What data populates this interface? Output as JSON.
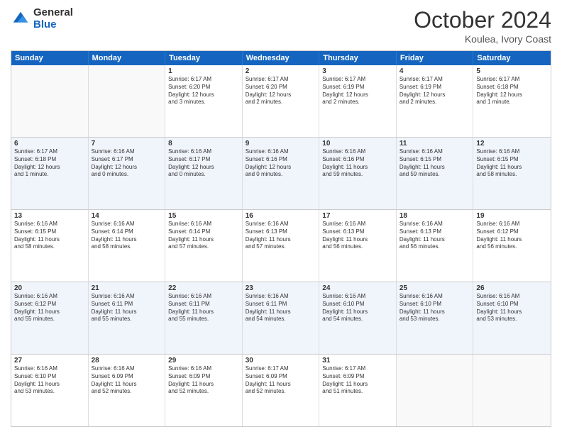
{
  "header": {
    "logo_line1": "General",
    "logo_line2": "Blue",
    "month": "October 2024",
    "location": "Koulea, Ivory Coast"
  },
  "days_of_week": [
    "Sunday",
    "Monday",
    "Tuesday",
    "Wednesday",
    "Thursday",
    "Friday",
    "Saturday"
  ],
  "rows": [
    {
      "cells": [
        {
          "day": "",
          "info": ""
        },
        {
          "day": "",
          "info": ""
        },
        {
          "day": "1",
          "info": "Sunrise: 6:17 AM\nSunset: 6:20 PM\nDaylight: 12 hours\nand 3 minutes."
        },
        {
          "day": "2",
          "info": "Sunrise: 6:17 AM\nSunset: 6:20 PM\nDaylight: 12 hours\nand 2 minutes."
        },
        {
          "day": "3",
          "info": "Sunrise: 6:17 AM\nSunset: 6:19 PM\nDaylight: 12 hours\nand 2 minutes."
        },
        {
          "day": "4",
          "info": "Sunrise: 6:17 AM\nSunset: 6:19 PM\nDaylight: 12 hours\nand 2 minutes."
        },
        {
          "day": "5",
          "info": "Sunrise: 6:17 AM\nSunset: 6:18 PM\nDaylight: 12 hours\nand 1 minute."
        }
      ]
    },
    {
      "cells": [
        {
          "day": "6",
          "info": "Sunrise: 6:17 AM\nSunset: 6:18 PM\nDaylight: 12 hours\nand 1 minute."
        },
        {
          "day": "7",
          "info": "Sunrise: 6:16 AM\nSunset: 6:17 PM\nDaylight: 12 hours\nand 0 minutes."
        },
        {
          "day": "8",
          "info": "Sunrise: 6:16 AM\nSunset: 6:17 PM\nDaylight: 12 hours\nand 0 minutes."
        },
        {
          "day": "9",
          "info": "Sunrise: 6:16 AM\nSunset: 6:16 PM\nDaylight: 12 hours\nand 0 minutes."
        },
        {
          "day": "10",
          "info": "Sunrise: 6:16 AM\nSunset: 6:16 PM\nDaylight: 11 hours\nand 59 minutes."
        },
        {
          "day": "11",
          "info": "Sunrise: 6:16 AM\nSunset: 6:15 PM\nDaylight: 11 hours\nand 59 minutes."
        },
        {
          "day": "12",
          "info": "Sunrise: 6:16 AM\nSunset: 6:15 PM\nDaylight: 11 hours\nand 58 minutes."
        }
      ]
    },
    {
      "cells": [
        {
          "day": "13",
          "info": "Sunrise: 6:16 AM\nSunset: 6:15 PM\nDaylight: 11 hours\nand 58 minutes."
        },
        {
          "day": "14",
          "info": "Sunrise: 6:16 AM\nSunset: 6:14 PM\nDaylight: 11 hours\nand 58 minutes."
        },
        {
          "day": "15",
          "info": "Sunrise: 6:16 AM\nSunset: 6:14 PM\nDaylight: 11 hours\nand 57 minutes."
        },
        {
          "day": "16",
          "info": "Sunrise: 6:16 AM\nSunset: 6:13 PM\nDaylight: 11 hours\nand 57 minutes."
        },
        {
          "day": "17",
          "info": "Sunrise: 6:16 AM\nSunset: 6:13 PM\nDaylight: 11 hours\nand 56 minutes."
        },
        {
          "day": "18",
          "info": "Sunrise: 6:16 AM\nSunset: 6:13 PM\nDaylight: 11 hours\nand 56 minutes."
        },
        {
          "day": "19",
          "info": "Sunrise: 6:16 AM\nSunset: 6:12 PM\nDaylight: 11 hours\nand 56 minutes."
        }
      ]
    },
    {
      "cells": [
        {
          "day": "20",
          "info": "Sunrise: 6:16 AM\nSunset: 6:12 PM\nDaylight: 11 hours\nand 55 minutes."
        },
        {
          "day": "21",
          "info": "Sunrise: 6:16 AM\nSunset: 6:11 PM\nDaylight: 11 hours\nand 55 minutes."
        },
        {
          "day": "22",
          "info": "Sunrise: 6:16 AM\nSunset: 6:11 PM\nDaylight: 11 hours\nand 55 minutes."
        },
        {
          "day": "23",
          "info": "Sunrise: 6:16 AM\nSunset: 6:11 PM\nDaylight: 11 hours\nand 54 minutes."
        },
        {
          "day": "24",
          "info": "Sunrise: 6:16 AM\nSunset: 6:10 PM\nDaylight: 11 hours\nand 54 minutes."
        },
        {
          "day": "25",
          "info": "Sunrise: 6:16 AM\nSunset: 6:10 PM\nDaylight: 11 hours\nand 53 minutes."
        },
        {
          "day": "26",
          "info": "Sunrise: 6:16 AM\nSunset: 6:10 PM\nDaylight: 11 hours\nand 53 minutes."
        }
      ]
    },
    {
      "cells": [
        {
          "day": "27",
          "info": "Sunrise: 6:16 AM\nSunset: 6:10 PM\nDaylight: 11 hours\nand 53 minutes."
        },
        {
          "day": "28",
          "info": "Sunrise: 6:16 AM\nSunset: 6:09 PM\nDaylight: 11 hours\nand 52 minutes."
        },
        {
          "day": "29",
          "info": "Sunrise: 6:16 AM\nSunset: 6:09 PM\nDaylight: 11 hours\nand 52 minutes."
        },
        {
          "day": "30",
          "info": "Sunrise: 6:17 AM\nSunset: 6:09 PM\nDaylight: 11 hours\nand 52 minutes."
        },
        {
          "day": "31",
          "info": "Sunrise: 6:17 AM\nSunset: 6:09 PM\nDaylight: 11 hours\nand 51 minutes."
        },
        {
          "day": "",
          "info": ""
        },
        {
          "day": "",
          "info": ""
        }
      ]
    }
  ]
}
